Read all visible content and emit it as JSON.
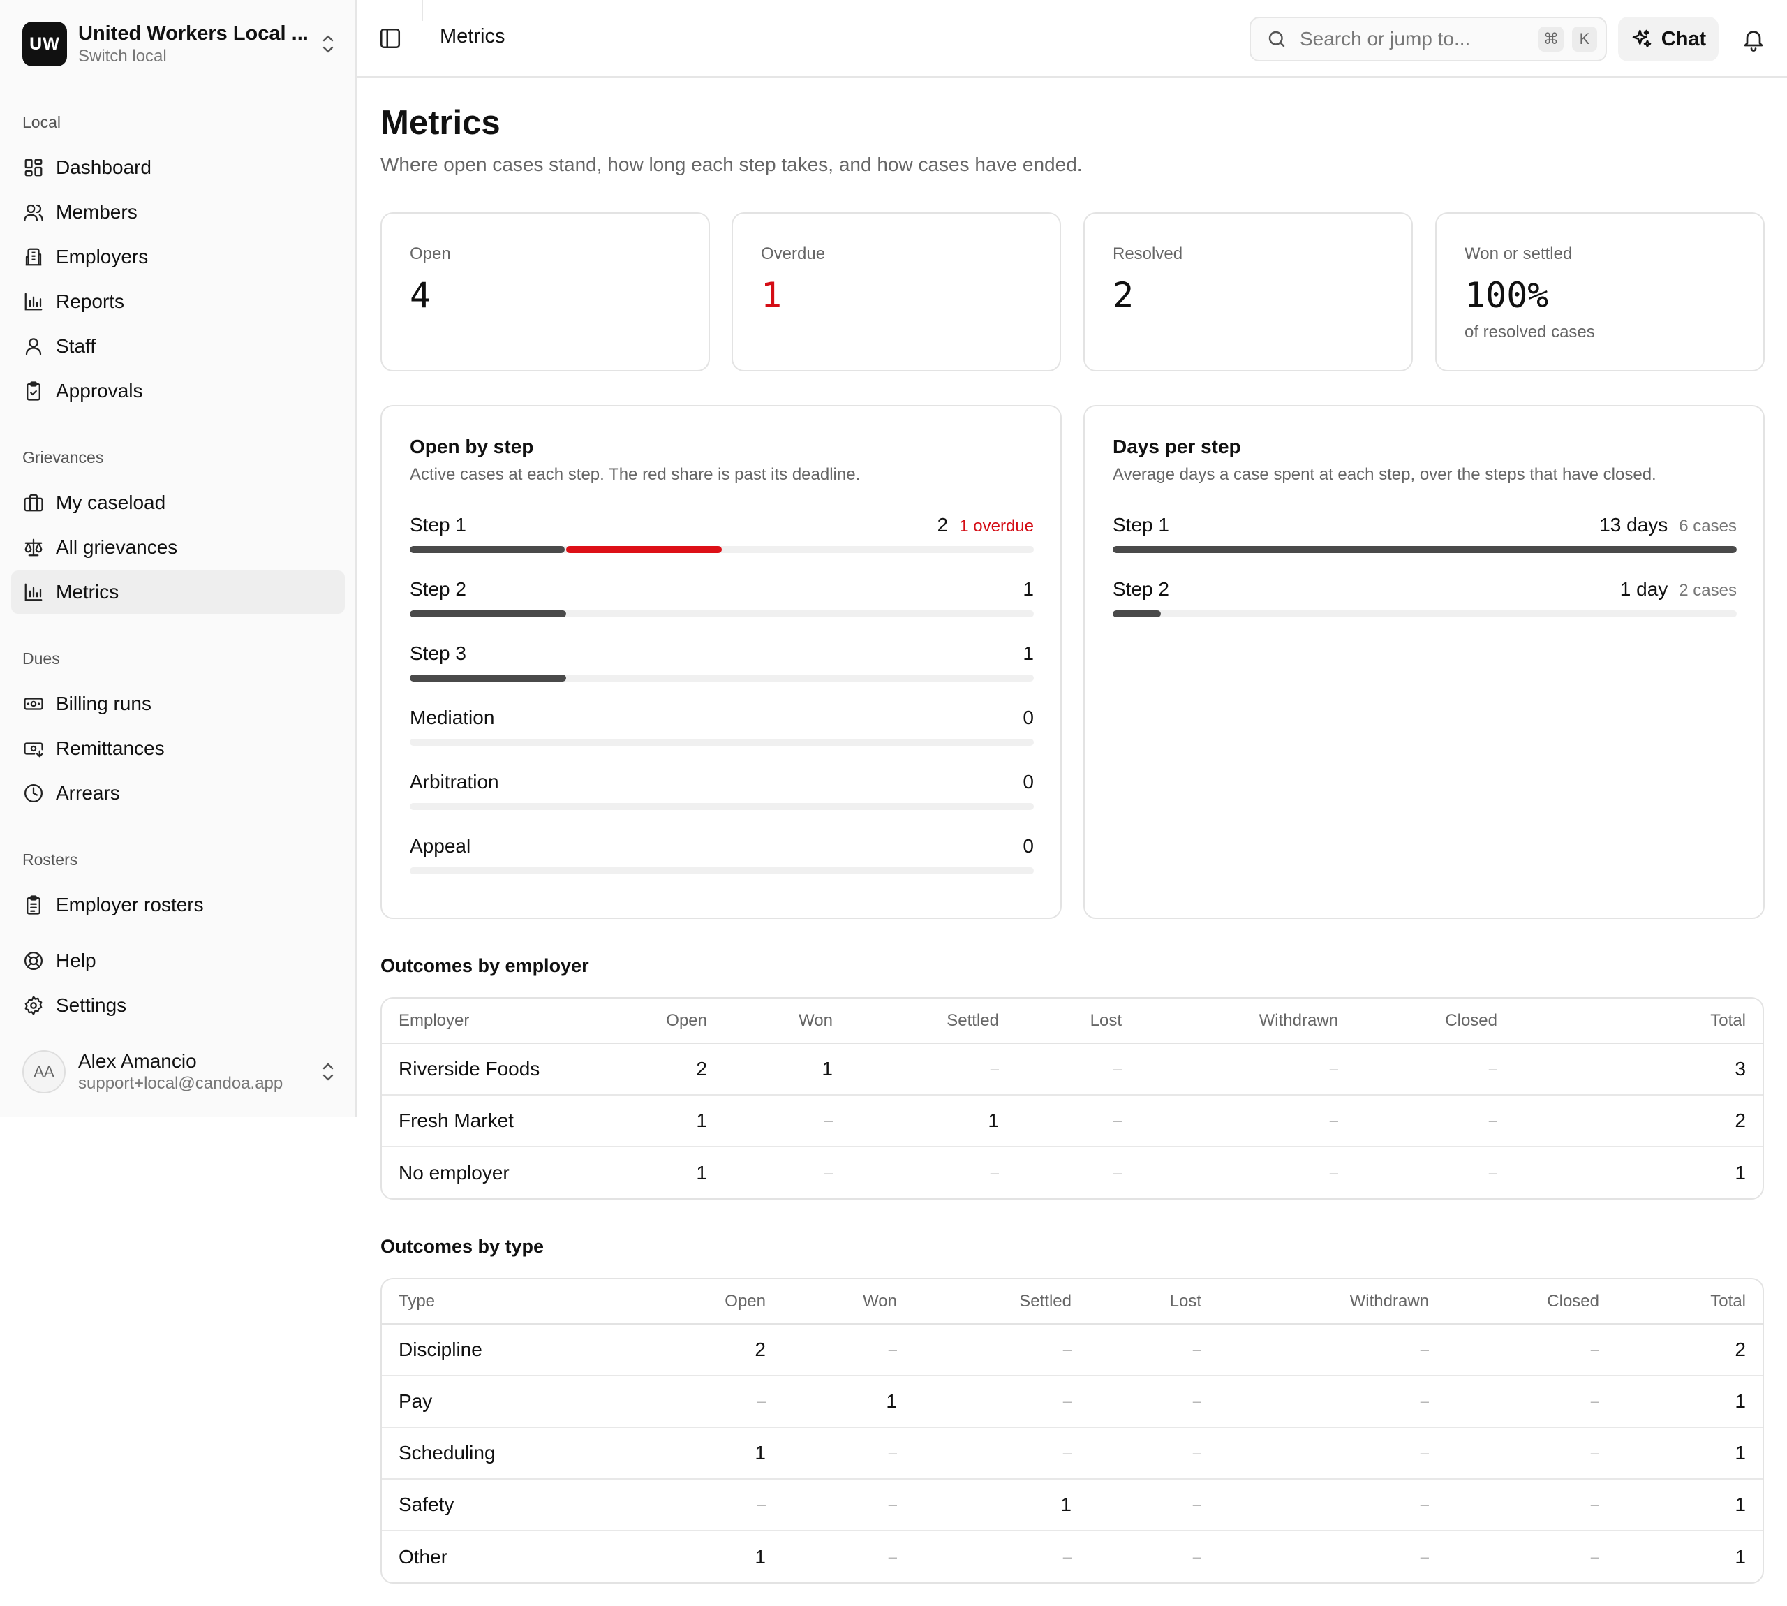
{
  "org": {
    "initials": "UW",
    "name": "United Workers Local ...",
    "switch_label": "Switch local"
  },
  "sidebar": {
    "sections": [
      {
        "label": "Local",
        "items": [
          {
            "label": "Dashboard",
            "icon": "dashboard-icon"
          },
          {
            "label": "Members",
            "icon": "members-icon"
          },
          {
            "label": "Employers",
            "icon": "building-icon"
          },
          {
            "label": "Reports",
            "icon": "bar-chart-icon"
          },
          {
            "label": "Staff",
            "icon": "user-icon"
          },
          {
            "label": "Approvals",
            "icon": "clipboard-check-icon"
          }
        ]
      },
      {
        "label": "Grievances",
        "items": [
          {
            "label": "My caseload",
            "icon": "briefcase-icon"
          },
          {
            "label": "All grievances",
            "icon": "scale-icon"
          },
          {
            "label": "Metrics",
            "icon": "bar-chart-icon",
            "active": true
          }
        ]
      },
      {
        "label": "Dues",
        "items": [
          {
            "label": "Billing runs",
            "icon": "banknote-icon"
          },
          {
            "label": "Remittances",
            "icon": "banknote-arrow-icon"
          },
          {
            "label": "Arrears",
            "icon": "clock-icon"
          }
        ]
      },
      {
        "label": "Rosters",
        "items": [
          {
            "label": "Employer rosters",
            "icon": "clipboard-list-icon"
          }
        ]
      }
    ],
    "footer_items": [
      {
        "label": "Help",
        "icon": "life-buoy-icon"
      },
      {
        "label": "Settings",
        "icon": "gear-icon"
      }
    ],
    "user": {
      "initials": "AA",
      "name": "Alex Amancio",
      "email": "support+local@candoa.app"
    }
  },
  "topbar": {
    "title": "Metrics",
    "search_placeholder": "Search or jump to...",
    "shortcut_keys": [
      "⌘",
      "K"
    ],
    "chat_label": "Chat"
  },
  "page": {
    "title": "Metrics",
    "subtitle": "Where open cases stand, how long each step takes, and how cases have ended."
  },
  "kpis": [
    {
      "label": "Open",
      "value": "4"
    },
    {
      "label": "Overdue",
      "value": "1",
      "color": "#d40d15"
    },
    {
      "label": "Resolved",
      "value": "2"
    },
    {
      "label": "Won or settled",
      "value": "100%",
      "sub": "of resolved cases"
    }
  ],
  "open_by_step": {
    "title": "Open by step",
    "subtitle": "Active cases at each step. The red share is past its deadline.",
    "max": 4,
    "rows": [
      {
        "step": "Step 1",
        "count": 2,
        "overdue": 1,
        "overdue_label": "1 overdue"
      },
      {
        "step": "Step 2",
        "count": 1,
        "overdue": 0
      },
      {
        "step": "Step 3",
        "count": 1,
        "overdue": 0
      },
      {
        "step": "Mediation",
        "count": 0,
        "overdue": 0
      },
      {
        "step": "Arbitration",
        "count": 0,
        "overdue": 0
      },
      {
        "step": "Appeal",
        "count": 0,
        "overdue": 0
      }
    ]
  },
  "days_per_step": {
    "title": "Days per step",
    "subtitle": "Average days a case spent at each step, over the steps that have closed.",
    "max": 13,
    "rows": [
      {
        "step": "Step 1",
        "days": 13,
        "days_label": "13 days",
        "cases_label": "6 cases"
      },
      {
        "step": "Step 2",
        "days": 1,
        "days_label": "1 day",
        "cases_label": "2 cases"
      }
    ]
  },
  "outcomes_by_employer": {
    "title": "Outcomes by employer",
    "columns": [
      "Employer",
      "Open",
      "Won",
      "Settled",
      "Lost",
      "Withdrawn",
      "Closed",
      "Total"
    ],
    "rows": [
      [
        "Riverside Foods",
        "2",
        "1",
        "–",
        "–",
        "–",
        "–",
        "3"
      ],
      [
        "Fresh Market",
        "1",
        "–",
        "1",
        "–",
        "–",
        "–",
        "2"
      ],
      [
        "No employer",
        "1",
        "–",
        "–",
        "–",
        "–",
        "–",
        "1"
      ]
    ]
  },
  "outcomes_by_type": {
    "title": "Outcomes by type",
    "columns": [
      "Type",
      "Open",
      "Won",
      "Settled",
      "Lost",
      "Withdrawn",
      "Closed",
      "Total"
    ],
    "rows": [
      [
        "Discipline",
        "2",
        "–",
        "–",
        "–",
        "–",
        "–",
        "2"
      ],
      [
        "Pay",
        "–",
        "1",
        "–",
        "–",
        "–",
        "–",
        "1"
      ],
      [
        "Scheduling",
        "1",
        "–",
        "–",
        "–",
        "–",
        "–",
        "1"
      ],
      [
        "Safety",
        "–",
        "–",
        "1",
        "–",
        "–",
        "–",
        "1"
      ],
      [
        "Other",
        "1",
        "–",
        "–",
        "–",
        "–",
        "–",
        "1"
      ]
    ]
  },
  "colors": {
    "accent_red": "#d40d15",
    "bar_dark": "#4a4a4a",
    "bar_track": "#f0f0f0"
  }
}
